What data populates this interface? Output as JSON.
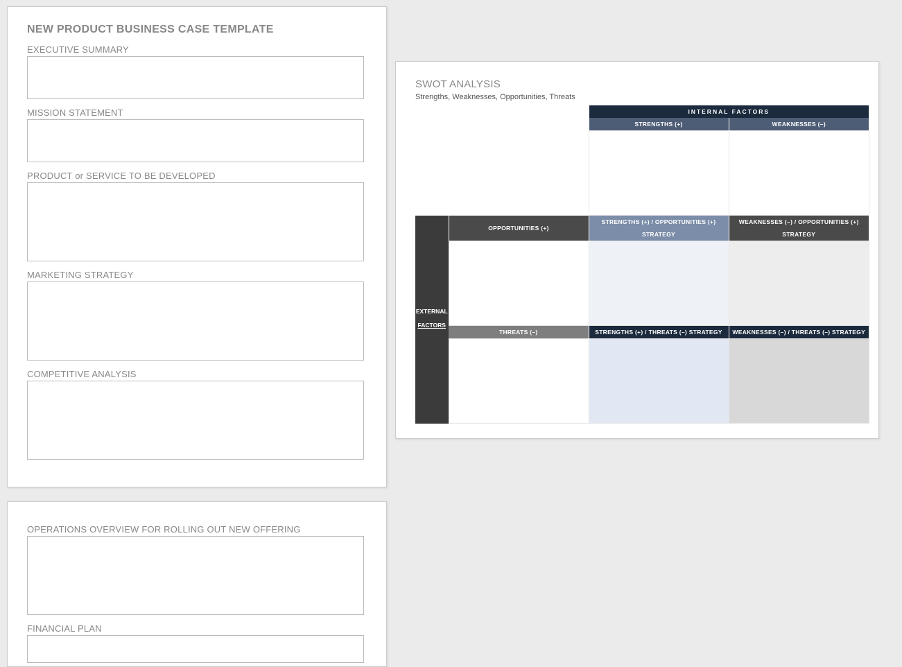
{
  "doc": {
    "title": "NEW PRODUCT BUSINESS CASE TEMPLATE",
    "sections": {
      "exec": "EXECUTIVE SUMMARY",
      "mission": "MISSION STATEMENT",
      "product": "PRODUCT or SERVICE TO BE DEVELOPED",
      "marketing": "MARKETING STRATEGY",
      "competitive": "COMPETITIVE ANALYSIS",
      "operations": "OPERATIONS OVERVIEW FOR ROLLING OUT NEW OFFERING",
      "financial": "FINANCIAL PLAN"
    }
  },
  "swot": {
    "title": "SWOT ANALYSIS",
    "subtitle": "Strengths, Weaknesses, Opportunities, Threats",
    "internal_label": "INTERNAL    FACTORS",
    "external_label_top": "EXTERNAL",
    "external_label_bot": "FACTORS",
    "strengths": "STRENGTHS (+)",
    "weaknesses": "WEAKNESSES (–)",
    "opportunities": "OPPORTUNITIES (+)",
    "threats": "THREATS (–)",
    "so": "STRENGTHS (+) / OPPORTUNITIES (+) STRATEGY",
    "wo": "WEAKNESSES (–) / OPPORTUNITIES (+) STRATEGY",
    "st": "STRENGTHS (+) / THREATS (–) STRATEGY",
    "wt": "WEAKNESSES (–) / THREATS (–) STRATEGY"
  }
}
